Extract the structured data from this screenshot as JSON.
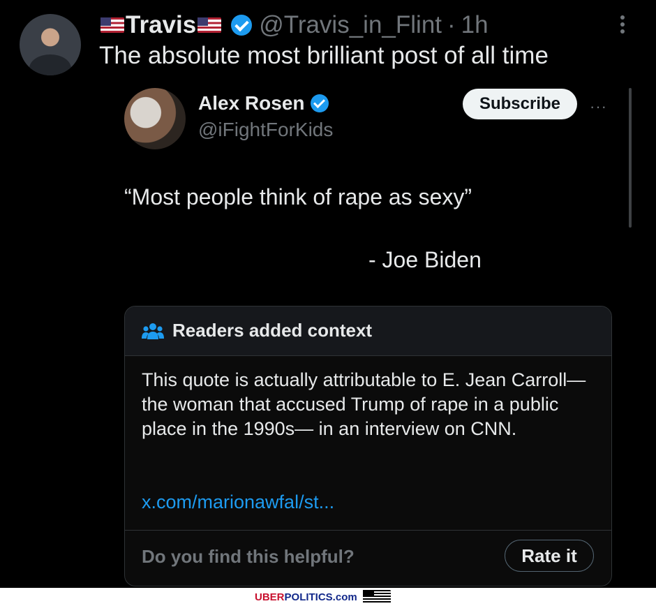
{
  "post": {
    "flag_left": "🇺🇸",
    "name": "Travis",
    "flag_right": "🇺🇸",
    "handle": "@Travis_in_Flint",
    "separator": "·",
    "time": "1h",
    "text": "The absolute most brilliant post of all time"
  },
  "quoted": {
    "name": "Alex Rosen",
    "handle": "@iFightForKids",
    "subscribe_label": "Subscribe",
    "more_label": "···",
    "quote": "“Most people think of rape as sexy”",
    "attribution": "- Joe Biden"
  },
  "context": {
    "title": "Readers added context",
    "body": "This quote is actually attributable to E. Jean Carroll— the woman that accused Trump of rape in a public place in the 1990s— in an interview on CNN.",
    "link": "x.com/marionawfal/st...",
    "helpful_question": "Do you find this helpful?",
    "rate_label": "Rate it"
  },
  "watermark": {
    "part1": "UBER",
    "part2": "POLITICS.com"
  },
  "colors": {
    "background": "#000000",
    "verified": "#1d9bf0",
    "link": "#1d9bf0",
    "muted": "#71767b"
  }
}
